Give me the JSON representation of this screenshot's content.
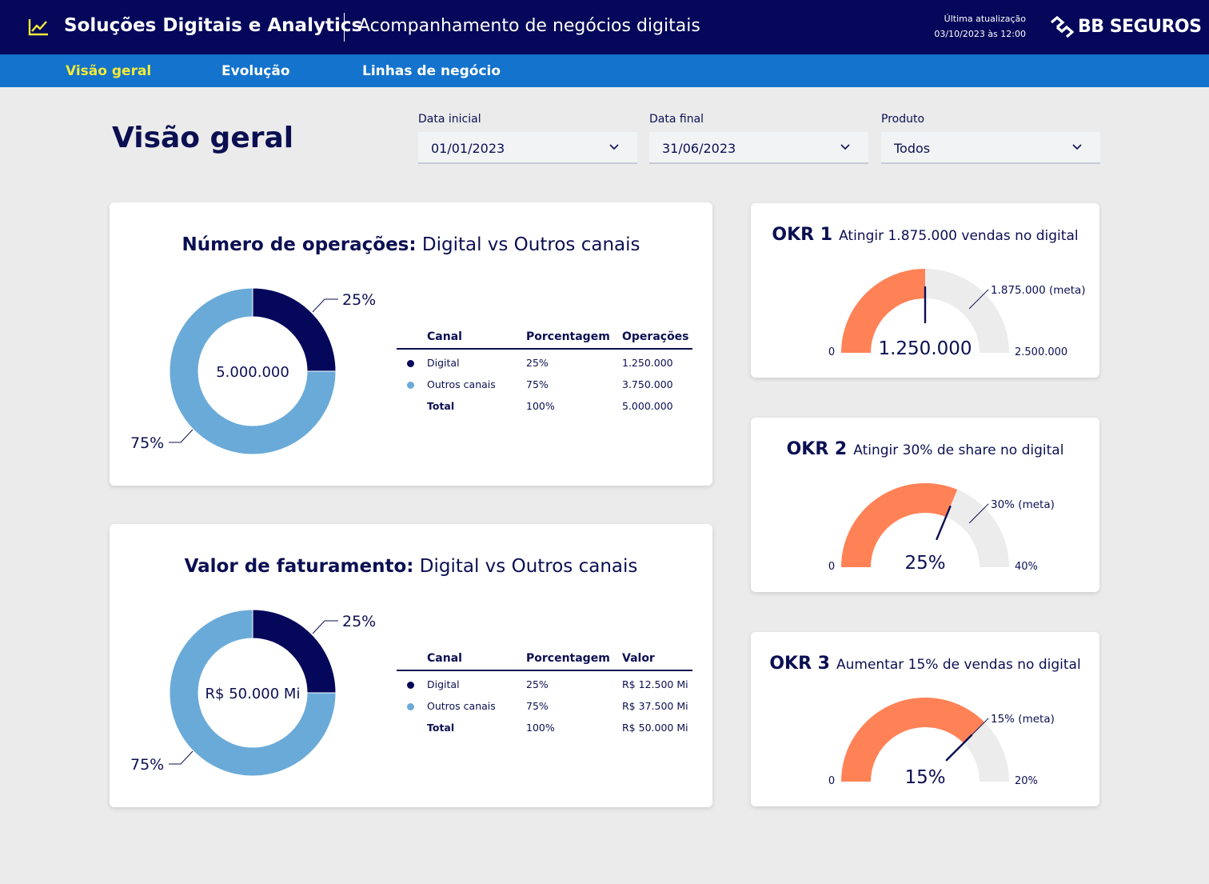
{
  "header": {
    "app_title": "Soluções Digitais e Analytics",
    "app_subtitle": "Acompanhamento de negócios digitais",
    "update_label": "Última atualização",
    "update_value": "03/10/2023 às 12:00",
    "brand": "BB SEGUROS",
    "icon": "line-chart-icon"
  },
  "nav": {
    "items": [
      {
        "label": "Visão geral",
        "active": true
      },
      {
        "label": "Evolução",
        "active": false
      },
      {
        "label": "Linhas de negócio",
        "active": false
      }
    ]
  },
  "page": {
    "title": "Visão geral"
  },
  "filters": [
    {
      "label": "Data inicial",
      "value": "01/01/2023"
    },
    {
      "label": "Data final",
      "value": "31/06/2023"
    },
    {
      "label": "Produto",
      "value": "Todos"
    }
  ],
  "colors": {
    "navy": "#05075a",
    "digital": "#05075a",
    "outros": "#6aaad8",
    "accent": "#ff8257",
    "track": "#ececec",
    "nav_active": "#f4ea37",
    "nav_bg": "#1373cd"
  },
  "operations": {
    "title_bold": "Número de operações:",
    "title_rest": " Digital vs Outros canais",
    "center_label": "5.000.000",
    "label_digital": "25%",
    "label_outros": "75%",
    "table": {
      "headers": [
        "Canal",
        "Porcentagem",
        "Operações"
      ],
      "rows": [
        {
          "canal": "Digital",
          "pct": "25%",
          "val": "1.250.000"
        },
        {
          "canal": "Outros canais",
          "pct": "75%",
          "val": "3.750.000"
        },
        {
          "canal": "Total",
          "pct": "100%",
          "val": "5.000.000"
        }
      ]
    }
  },
  "revenue": {
    "title_bold": "Valor de faturamento:",
    "title_rest": " Digital vs Outros canais",
    "center_label": "R$ 50.000 Mi",
    "label_digital": "25%",
    "label_outros": "75%",
    "table": {
      "headers": [
        "Canal",
        "Porcentagem",
        "Valor"
      ],
      "rows": [
        {
          "canal": "Digital",
          "pct": "25%",
          "val": "R$ 12.500 Mi"
        },
        {
          "canal": "Outros canais",
          "pct": "75%",
          "val": "R$ 37.500 Mi"
        },
        {
          "canal": "Total",
          "pct": "100%",
          "val": "R$ 50.000 Mi"
        }
      ]
    }
  },
  "okrs": [
    {
      "code": "OKR 1",
      "desc": "Atingir 1.875.000 vendas no digital",
      "value_label": "1.250.000",
      "min_label": "0",
      "max_label": "2.500.000",
      "target_label": "1.875.000 (meta)"
    },
    {
      "code": "OKR 2",
      "desc": "Atingir 30% de share no digital",
      "value_label": "25%",
      "min_label": "0",
      "max_label": "40%",
      "target_label": "30% (meta)"
    },
    {
      "code": "OKR 3",
      "desc": "Aumentar 15% de vendas no digital",
      "value_label": "15%",
      "min_label": "0",
      "max_label": "20%",
      "target_label": "15% (meta)"
    }
  ],
  "chart_data": [
    {
      "type": "pie",
      "title": "Número de operações: Digital vs Outros canais",
      "categories": [
        "Digital",
        "Outros canais"
      ],
      "values": [
        1250000,
        3750000
      ],
      "percent": [
        25,
        75
      ],
      "total": 5000000
    },
    {
      "type": "pie",
      "title": "Valor de faturamento: Digital vs Outros canais",
      "categories": [
        "Digital",
        "Outros canais"
      ],
      "values": [
        12500,
        37500
      ],
      "percent": [
        25,
        75
      ],
      "total": 50000
    },
    {
      "type": "gauge",
      "title": "OKR 1",
      "min": 0,
      "max": 2500000,
      "value": 1250000,
      "target": 1875000
    },
    {
      "type": "gauge",
      "title": "OKR 2",
      "min": 0,
      "max": 40,
      "value": 25,
      "target": 30
    },
    {
      "type": "gauge",
      "title": "OKR 3",
      "min": 0,
      "max": 20,
      "value": 15,
      "target": 15
    }
  ]
}
